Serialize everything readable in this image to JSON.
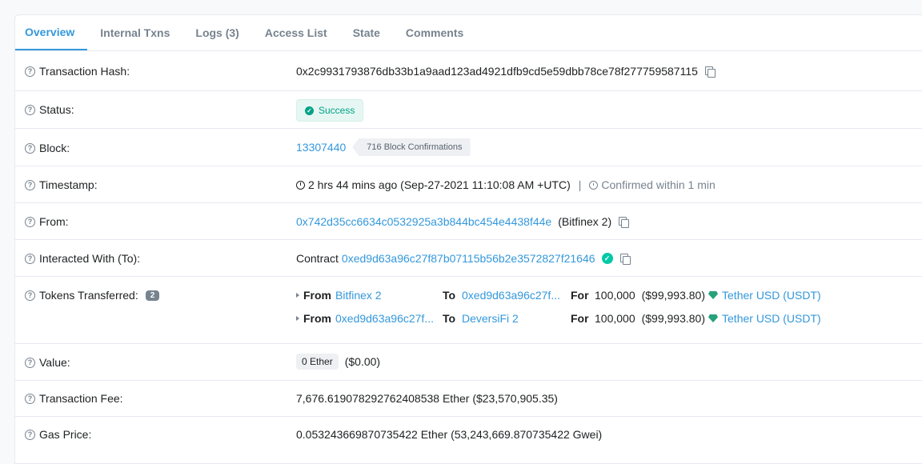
{
  "tabs": [
    {
      "label": "Overview"
    },
    {
      "label": "Internal Txns"
    },
    {
      "label": "Logs (3)"
    },
    {
      "label": "Access List"
    },
    {
      "label": "State"
    },
    {
      "label": "Comments"
    }
  ],
  "rows": {
    "tx_hash": {
      "label": "Transaction Hash:",
      "value": "0x2c9931793876db33b1a9aad123ad4921dfb9cd5e59dbb78ce78f277759587115"
    },
    "status": {
      "label": "Status:",
      "value": "Success"
    },
    "block": {
      "label": "Block:",
      "number": "13307440",
      "confirmations": "716 Block Confirmations"
    },
    "timestamp": {
      "label": "Timestamp:",
      "value": "2 hrs 44 mins ago (Sep-27-2021 11:10:08 AM +UTC)",
      "separator": "|",
      "confirmed": "Confirmed within 1 min"
    },
    "from": {
      "label": "From:",
      "address": "0x742d35cc6634c0532925a3b844bc454e4438f44e",
      "name": "(Bitfinex 2)"
    },
    "to": {
      "label": "Interacted With (To):",
      "prefix": "Contract",
      "address": "0xed9d63a96c27f87b07115b56b2e3572827f21646"
    },
    "tokens": {
      "label": "Tokens Transferred:",
      "count": "2",
      "transfers": [
        {
          "from_kw": "From",
          "from": "Bitfinex 2",
          "to_kw": "To",
          "to": "0xed9d63a96c27f...",
          "for_kw": "For",
          "amount": "100,000",
          "usd": "($99,993.80)",
          "token": "Tether USD (USDT)"
        },
        {
          "from_kw": "From",
          "from": "0xed9d63a96c27f...",
          "to_kw": "To",
          "to": "DeversiFi 2",
          "for_kw": "For",
          "amount": "100,000",
          "usd": "($99,993.80)",
          "token": "Tether USD (USDT)"
        }
      ]
    },
    "value": {
      "label": "Value:",
      "ether": "0 Ether",
      "usd": "($0.00)"
    },
    "fee": {
      "label": "Transaction Fee:",
      "value": "7,676.619078292762408538 Ether ($23,570,905.35)"
    },
    "gas": {
      "label": "Gas Price:",
      "value": "0.053243669870735422 Ether (53,243,669.870735422 Gwei)"
    }
  },
  "icons": {
    "help": "question-circle-icon",
    "copy": "copy-icon",
    "clock": "clock-icon",
    "timer": "timer-icon",
    "verified": "check-circle-icon",
    "token": "tether-gem-icon"
  },
  "colors": {
    "link": "#3498db",
    "success": "#00a186",
    "muted": "#77838f"
  }
}
